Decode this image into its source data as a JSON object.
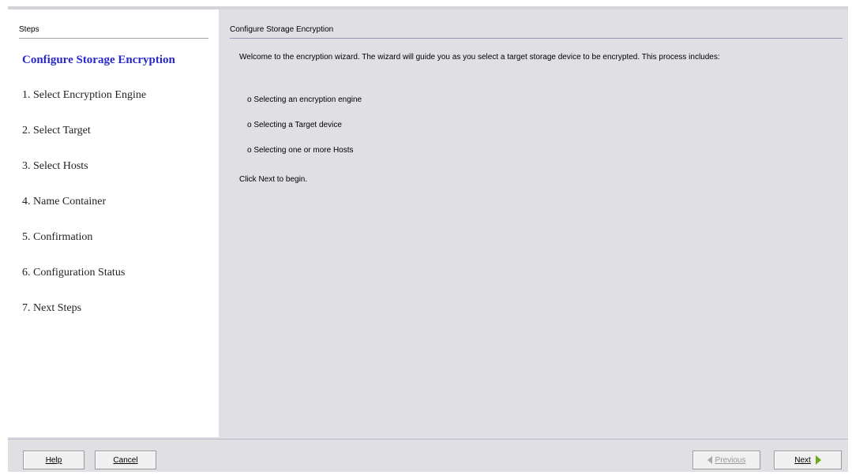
{
  "steps_panel": {
    "header": "Steps",
    "items": [
      {
        "label": "Configure Storage Encryption",
        "current": true
      },
      {
        "label": "1. Select Encryption Engine"
      },
      {
        "label": "2. Select Target"
      },
      {
        "label": "3. Select Hosts"
      },
      {
        "label": "4. Name Container"
      },
      {
        "label": "5. Confirmation"
      },
      {
        "label": "6. Configuration Status"
      },
      {
        "label": "7. Next Steps"
      }
    ]
  },
  "content": {
    "title": "Configure Storage Encryption",
    "intro": "Welcome to the encryption wizard. The wizard will guide you as you select a target storage device to be encrypted. This process includes:",
    "bullets": [
      "o Selecting an encryption engine",
      "o Selecting a Target device",
      "o Selecting one or more Hosts"
    ],
    "closing": "Click Next to begin."
  },
  "buttons": {
    "help": "Help",
    "cancel": "Cancel",
    "previous": "Previous",
    "next": "Next"
  },
  "colors": {
    "current_step": "#2828c8",
    "next_arrow": "#6aaa1e"
  }
}
